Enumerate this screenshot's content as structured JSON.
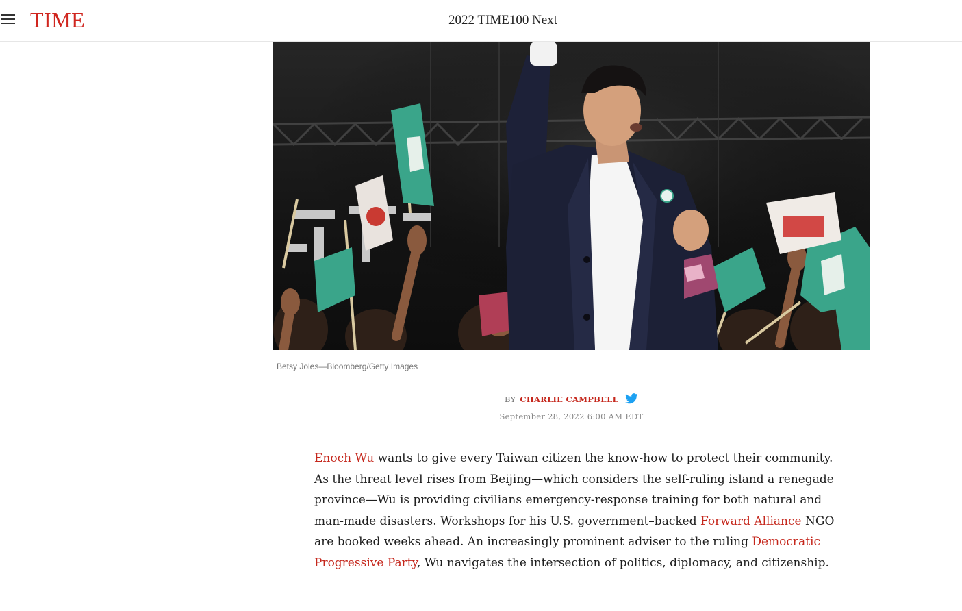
{
  "header": {
    "logo": "TIME",
    "section_title": "2022 TIME100 Next"
  },
  "hero": {
    "credit": "Betsy Joles—Bloomberg/Getty Images"
  },
  "byline": {
    "prefix": "By",
    "author": "Charlie Campbell",
    "date": "September 28, 2022 6:00 AM EDT"
  },
  "article": {
    "link_enoch": "Enoch Wu",
    "text_1": " wants to give every Taiwan citizen the know-how to protect their community. As the threat level rises from Beijing—which considers the self-ruling island a renegade province—Wu is providing civilians emergency-response training for both natural and man-made disasters. Workshops for his U.S. government–backed ",
    "link_forward": "Forward Alliance",
    "text_2": " NGO are booked weeks ahead. An increasingly prominent adviser to the ruling ",
    "link_dpp": "Democratic Progressive Party",
    "text_3": ", Wu navigates the intersection of politics, diplomacy, and citizenship."
  },
  "colors": {
    "brand_red": "#d0261f",
    "link_red": "#c5271c",
    "twitter_blue": "#1da1f2"
  }
}
